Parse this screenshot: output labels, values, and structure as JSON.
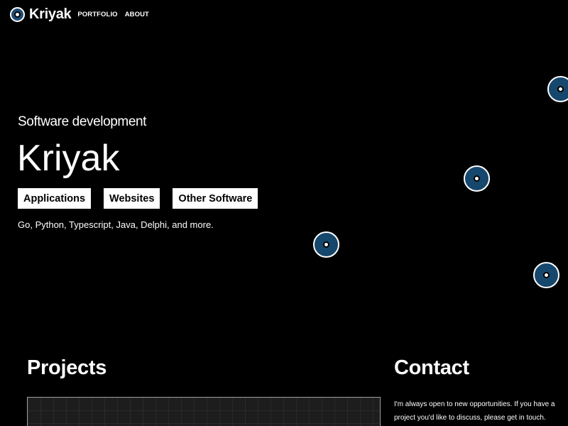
{
  "nav": {
    "brand": "Kriyak",
    "links": [
      "PORTFOLIO",
      "ABOUT"
    ]
  },
  "hero": {
    "subtitle": "Software development",
    "title": "Kriyak",
    "buttons": [
      "Applications",
      "Websites",
      "Other Software"
    ],
    "languages": "Go, Python, Typescript, Java, Delphi, and more."
  },
  "projects": {
    "title": "Projects"
  },
  "contact": {
    "title": "Contact",
    "text": "I'm always open to new opportunities. If you have a project you'd like to discuss, please get in touch."
  },
  "colors": {
    "background": "#000000",
    "accent": "#16476d",
    "text": "#ffffff"
  },
  "icons": {
    "logo": "kriyak-logo-icon",
    "node": "network-node-icon"
  }
}
